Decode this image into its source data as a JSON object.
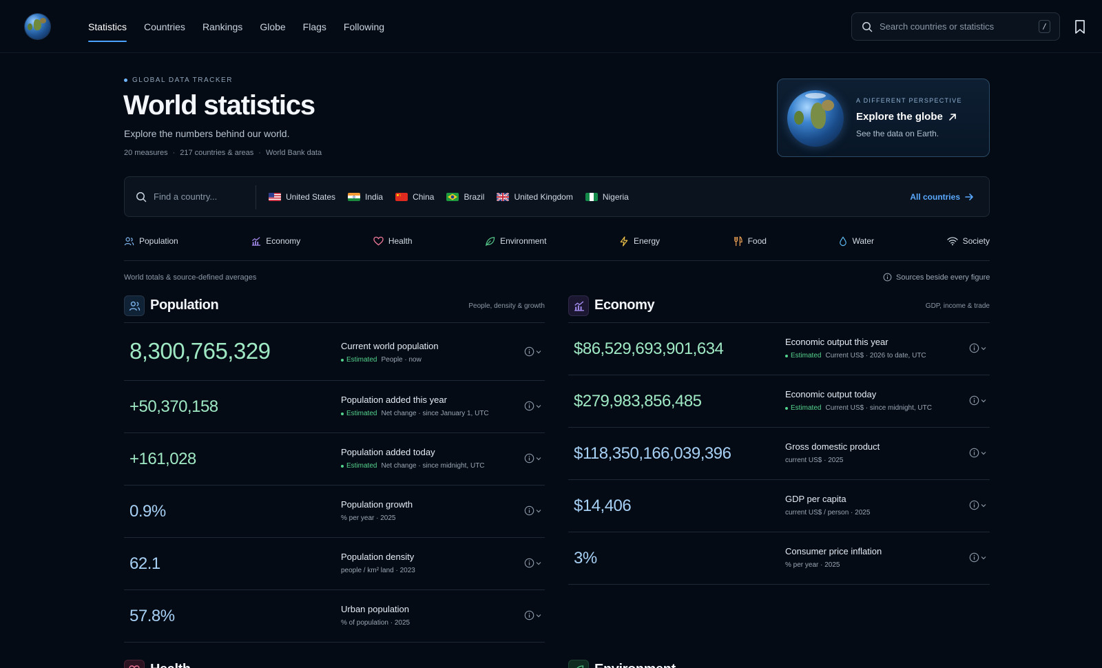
{
  "nav": {
    "items": [
      "Statistics",
      "Countries",
      "Rankings",
      "Globe",
      "Flags",
      "Following"
    ],
    "active": "Statistics"
  },
  "search": {
    "placeholder": "Search countries or statistics",
    "shortcut": "/"
  },
  "hero": {
    "eyebrow": "GLOBAL DATA TRACKER",
    "title": "World statistics",
    "subtitle": "Explore the numbers behind our world.",
    "meta": [
      "20 measures",
      "217 countries & areas",
      "World Bank data"
    ]
  },
  "globe_card": {
    "eyebrow": "A DIFFERENT PERSPECTIVE",
    "title": "Explore the globe",
    "subtitle": "See the data on Earth."
  },
  "country_bar": {
    "placeholder": "Find a country...",
    "countries": [
      "United States",
      "India",
      "China",
      "Brazil",
      "United Kingdom",
      "Nigeria"
    ],
    "all_label": "All countries"
  },
  "categories": [
    "Population",
    "Economy",
    "Health",
    "Environment",
    "Energy",
    "Food",
    "Water",
    "Society"
  ],
  "notes": {
    "left": "World totals & source-defined averages",
    "right": "Sources beside every figure"
  },
  "population": {
    "title": "Population",
    "tag": "People, density & growth",
    "rows": [
      {
        "value": "8,300,765,329",
        "label": "Current world population",
        "estimated": "Estimated",
        "sub": "People · now"
      },
      {
        "value": "+50,370,158",
        "label": "Population added this year",
        "estimated": "Estimated",
        "sub": "Net change · since January 1, UTC"
      },
      {
        "value": "+161,028",
        "label": "Population added today",
        "estimated": "Estimated",
        "sub": "Net change · since midnight, UTC"
      },
      {
        "value": "0.9%",
        "label": "Population growth",
        "sub": "% per year · 2025"
      },
      {
        "value": "62.1",
        "label": "Population density",
        "sub": "people / km² land · 2023"
      },
      {
        "value": "57.8%",
        "label": "Urban population",
        "sub": "% of population · 2025"
      }
    ]
  },
  "economy": {
    "title": "Economy",
    "tag": "GDP, income & trade",
    "rows": [
      {
        "value": "$86,529,693,901,634",
        "label": "Economic output this year",
        "estimated": "Estimated",
        "sub": "Current US$ · 2026 to date, UTC"
      },
      {
        "value": "$279,983,856,485",
        "label": "Economic output today",
        "estimated": "Estimated",
        "sub": "Current US$ · since midnight, UTC"
      },
      {
        "value": "$118,350,166,039,396",
        "label": "Gross domestic product",
        "sub": "current US$ · 2025"
      },
      {
        "value": "$14,406",
        "label": "GDP per capita",
        "sub": "current US$ / person · 2025"
      },
      {
        "value": "3%",
        "label": "Consumer price inflation",
        "sub": "% per year · 2025"
      }
    ]
  },
  "next_sections": [
    "Health",
    "Environment"
  ],
  "colors": {
    "accent": "#4aa3ff",
    "estimated": "#54d38e",
    "live_value": "#9fe8c4",
    "static_value": "#a7d0f5"
  }
}
